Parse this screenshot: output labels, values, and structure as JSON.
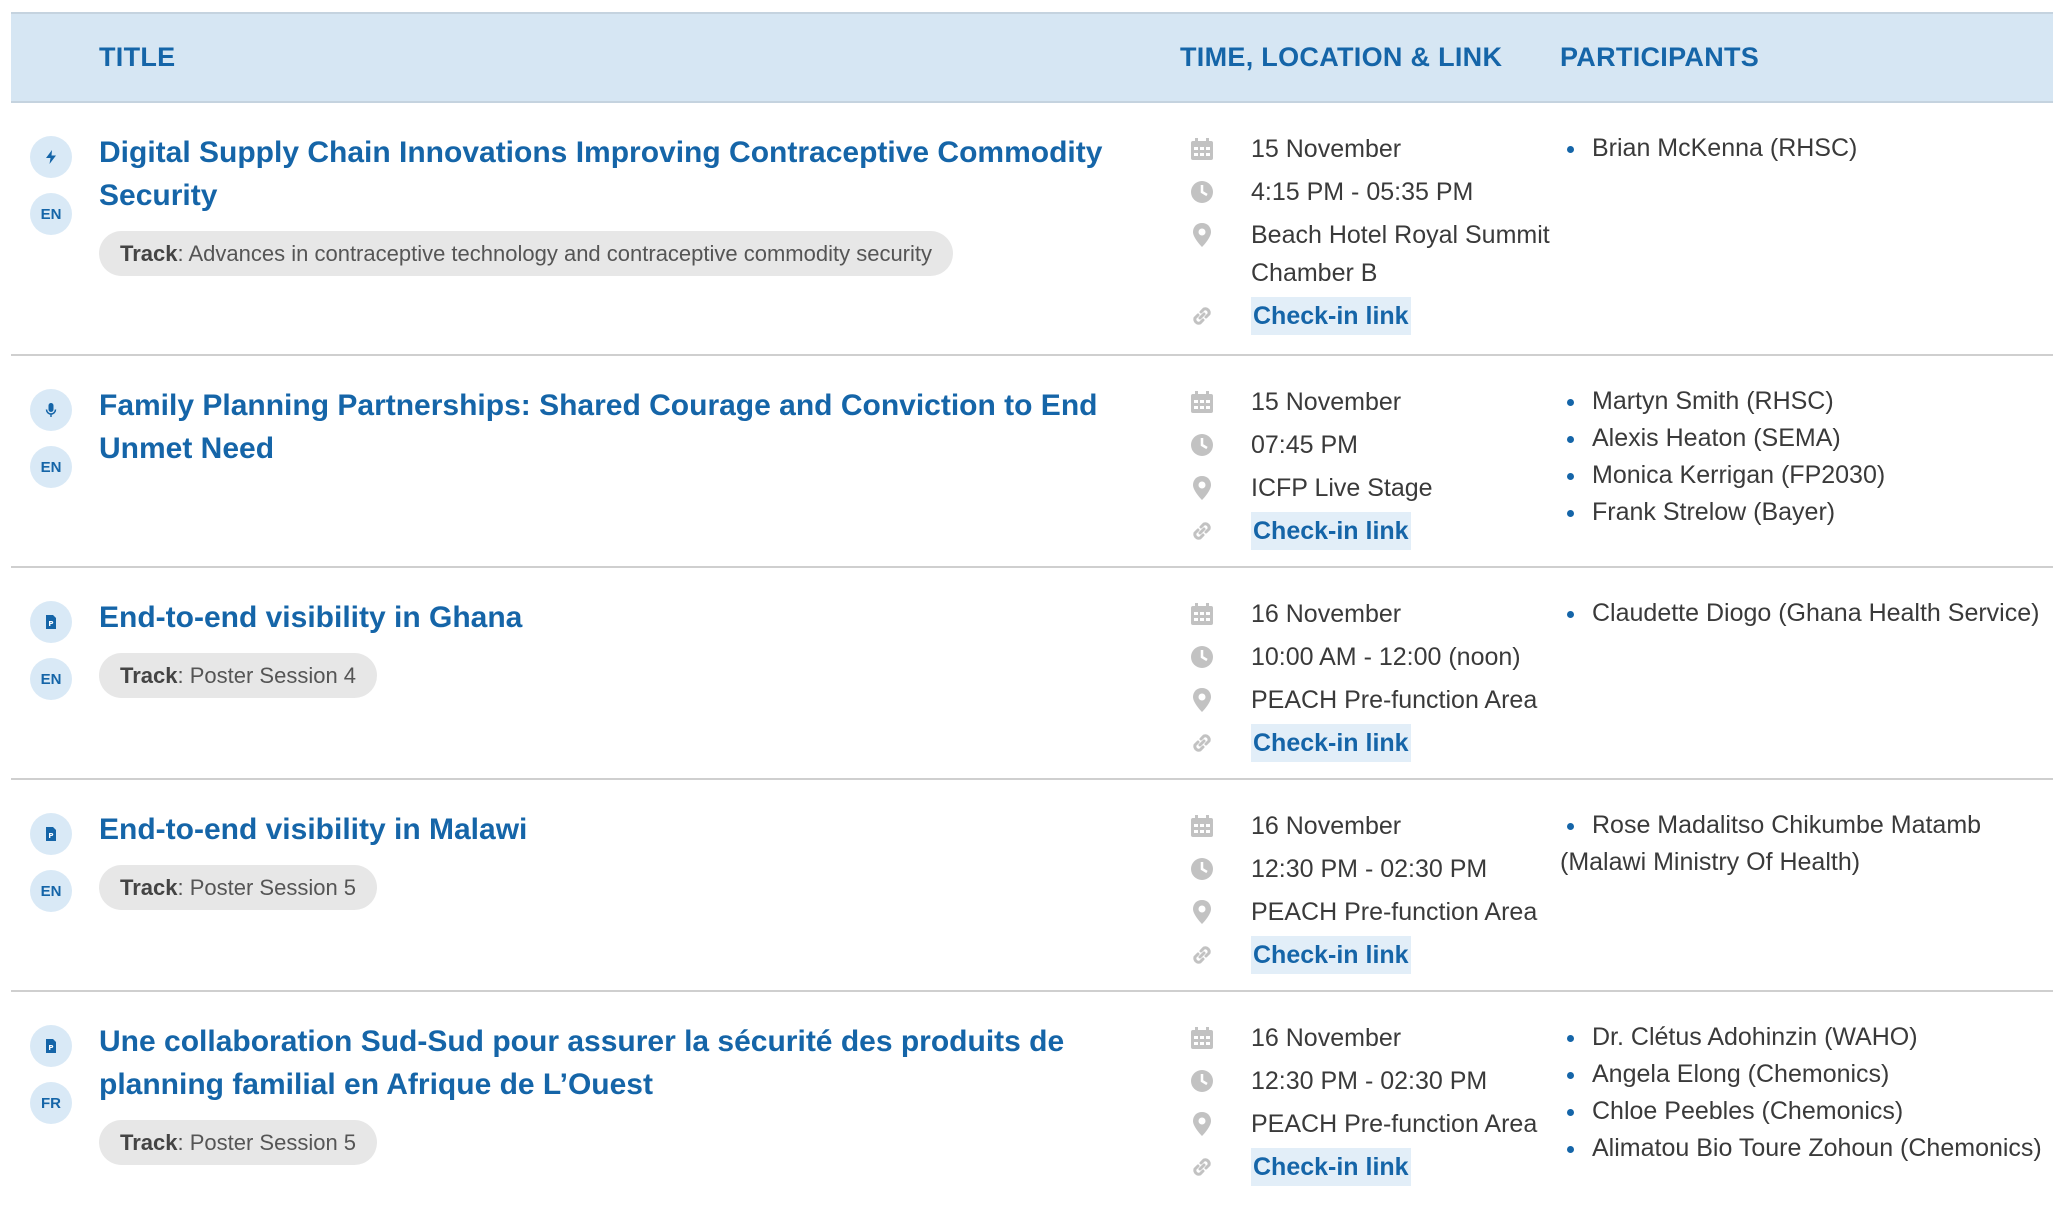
{
  "header": {
    "title": "TITLE",
    "time": "TIME, LOCATION & LINK",
    "participants": "PARTICIPANTS"
  },
  "sessions": [
    {
      "type_icon": "lightning-icon",
      "lang": "EN",
      "title": "Digital Supply Chain Innovations Improving Contraceptive Commodity Security",
      "track_label": "Track",
      "track_value": ": Advances in contraceptive technology and contraceptive commodity security",
      "date": "15 November",
      "time": "4:15 PM - 05:35 PM",
      "location": "Beach Hotel Royal Summit Chamber B",
      "link": "Check-in link",
      "participants": [
        "Brian McKenna (RHSC)"
      ]
    },
    {
      "type_icon": "microphone-icon",
      "lang": "EN",
      "title": "Family Planning Partnerships: Shared Courage and Conviction to End Unmet Need",
      "date": "15 November",
      "time": "07:45 PM",
      "location": "ICFP Live Stage",
      "link": "Check-in link",
      "participants": [
        "Martyn Smith (RHSC)",
        "Alexis Heaton (SEMA)",
        "Monica Kerrigan (FP2030)",
        "Frank Strelow (Bayer)"
      ]
    },
    {
      "type_icon": "poster-icon",
      "lang": "EN",
      "title": "End-to-end visibility in Ghana",
      "track_label": "Track",
      "track_value": ": Poster Session 4",
      "date": "16 November",
      "time": "10:00 AM - 12:00 (noon)",
      "location": "PEACH Pre-function Area",
      "link": "Check-in link",
      "participants": [
        "Claudette Diogo (Ghana Health Service)"
      ]
    },
    {
      "type_icon": "poster-icon",
      "lang": "EN",
      "title": "End-to-end visibility in Malawi",
      "track_label": "Track",
      "track_value": ": Poster Session 5",
      "date": "16 November",
      "time": "12:30 PM - 02:30 PM",
      "location": "PEACH Pre-function Area",
      "link": "Check-in link",
      "participants": [
        "Rose Madalitso Chikumbe Matamb (Malawi Ministry Of Health)"
      ]
    },
    {
      "type_icon": "poster-icon",
      "lang": "FR",
      "title": "Une collaboration Sud-Sud pour assurer la sécurité des produits de planning familial en Afrique de L’Ouest",
      "track_label": "Track",
      "track_value": ": Poster Session 5",
      "date": "16 November",
      "time": "12:30 PM - 02:30 PM",
      "location": "PEACH Pre-function Area",
      "link": "Check-in link",
      "participants": [
        "Dr. Clétus Adohinzin (WAHO)",
        "Angela Elong (Chemonics)",
        "Chloe Peebles (Chemonics)",
        "Alimatou Bio Toure Zohoun (Chemonics)"
      ]
    }
  ],
  "colors": {
    "accent": "#1565a8",
    "header_bg": "#d6e6f3",
    "badge_bg": "#d9e9f6",
    "icon_gray": "#c2c2c2"
  }
}
